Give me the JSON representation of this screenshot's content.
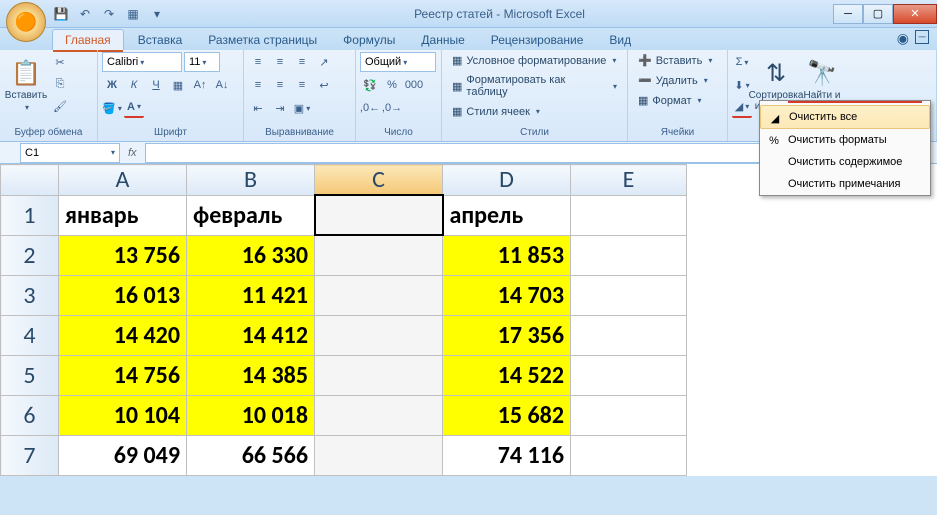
{
  "window": {
    "title": "Реестр статей - Microsoft Excel"
  },
  "qat": {
    "save": "💾",
    "undo": "↶",
    "redo": "↷",
    "extra": "▦"
  },
  "tabs": {
    "items": [
      "Главная",
      "Вставка",
      "Разметка страницы",
      "Формулы",
      "Данные",
      "Рецензирование",
      "Вид"
    ],
    "active": 0
  },
  "ribbon": {
    "clipboard": {
      "label": "Буфер обмена",
      "paste": "Вставить"
    },
    "font": {
      "label": "Шрифт",
      "name": "Calibri",
      "size": "11"
    },
    "alignment": {
      "label": "Выравнивание"
    },
    "number": {
      "label": "Число",
      "format": "Общий"
    },
    "styles": {
      "label": "Стили",
      "conditional": "Условное форматирование",
      "table": "Форматировать как таблицу",
      "cell": "Стили ячеек"
    },
    "cells": {
      "label": "Ячейки",
      "insert": "Вставить",
      "delete": "Удалить",
      "format": "Формат"
    },
    "editing": {
      "sort": "Сортировка и фильтр",
      "find": "Найти и выделить"
    }
  },
  "clear_menu": {
    "items": [
      "Очистить все",
      "Очистить форматы",
      "Очистить содержимое",
      "Очистить примечания"
    ],
    "highlighted": 0
  },
  "formula_bar": {
    "cell_ref": "C1",
    "fx": "fx"
  },
  "grid": {
    "columns": [
      "A",
      "B",
      "C",
      "D",
      "E"
    ],
    "selected_col": "C",
    "rows": [
      {
        "n": "1",
        "cells": [
          "январь",
          "февраль",
          "",
          "апрель",
          ""
        ]
      },
      {
        "n": "2",
        "cells": [
          "13 756",
          "16 330",
          "",
          "11 853",
          ""
        ]
      },
      {
        "n": "3",
        "cells": [
          "16 013",
          "11 421",
          "",
          "14 703",
          ""
        ]
      },
      {
        "n": "4",
        "cells": [
          "14 420",
          "14 412",
          "",
          "17 356",
          ""
        ]
      },
      {
        "n": "5",
        "cells": [
          "14 756",
          "14 385",
          "",
          "14 522",
          ""
        ]
      },
      {
        "n": "6",
        "cells": [
          "10 104",
          "10 018",
          "",
          "15 682",
          ""
        ]
      },
      {
        "n": "7",
        "cells": [
          "69 049",
          "66 566",
          "",
          "74 116",
          ""
        ]
      }
    ]
  },
  "chart_data": {
    "type": "table",
    "columns": [
      "январь",
      "февраль",
      "апрель"
    ],
    "data": [
      [
        13756,
        16330,
        11853
      ],
      [
        16013,
        11421,
        14703
      ],
      [
        14420,
        14412,
        17356
      ],
      [
        14756,
        14385,
        14522
      ],
      [
        10104,
        10018,
        15682
      ]
    ],
    "totals": [
      69049,
      66566,
      74116
    ]
  }
}
